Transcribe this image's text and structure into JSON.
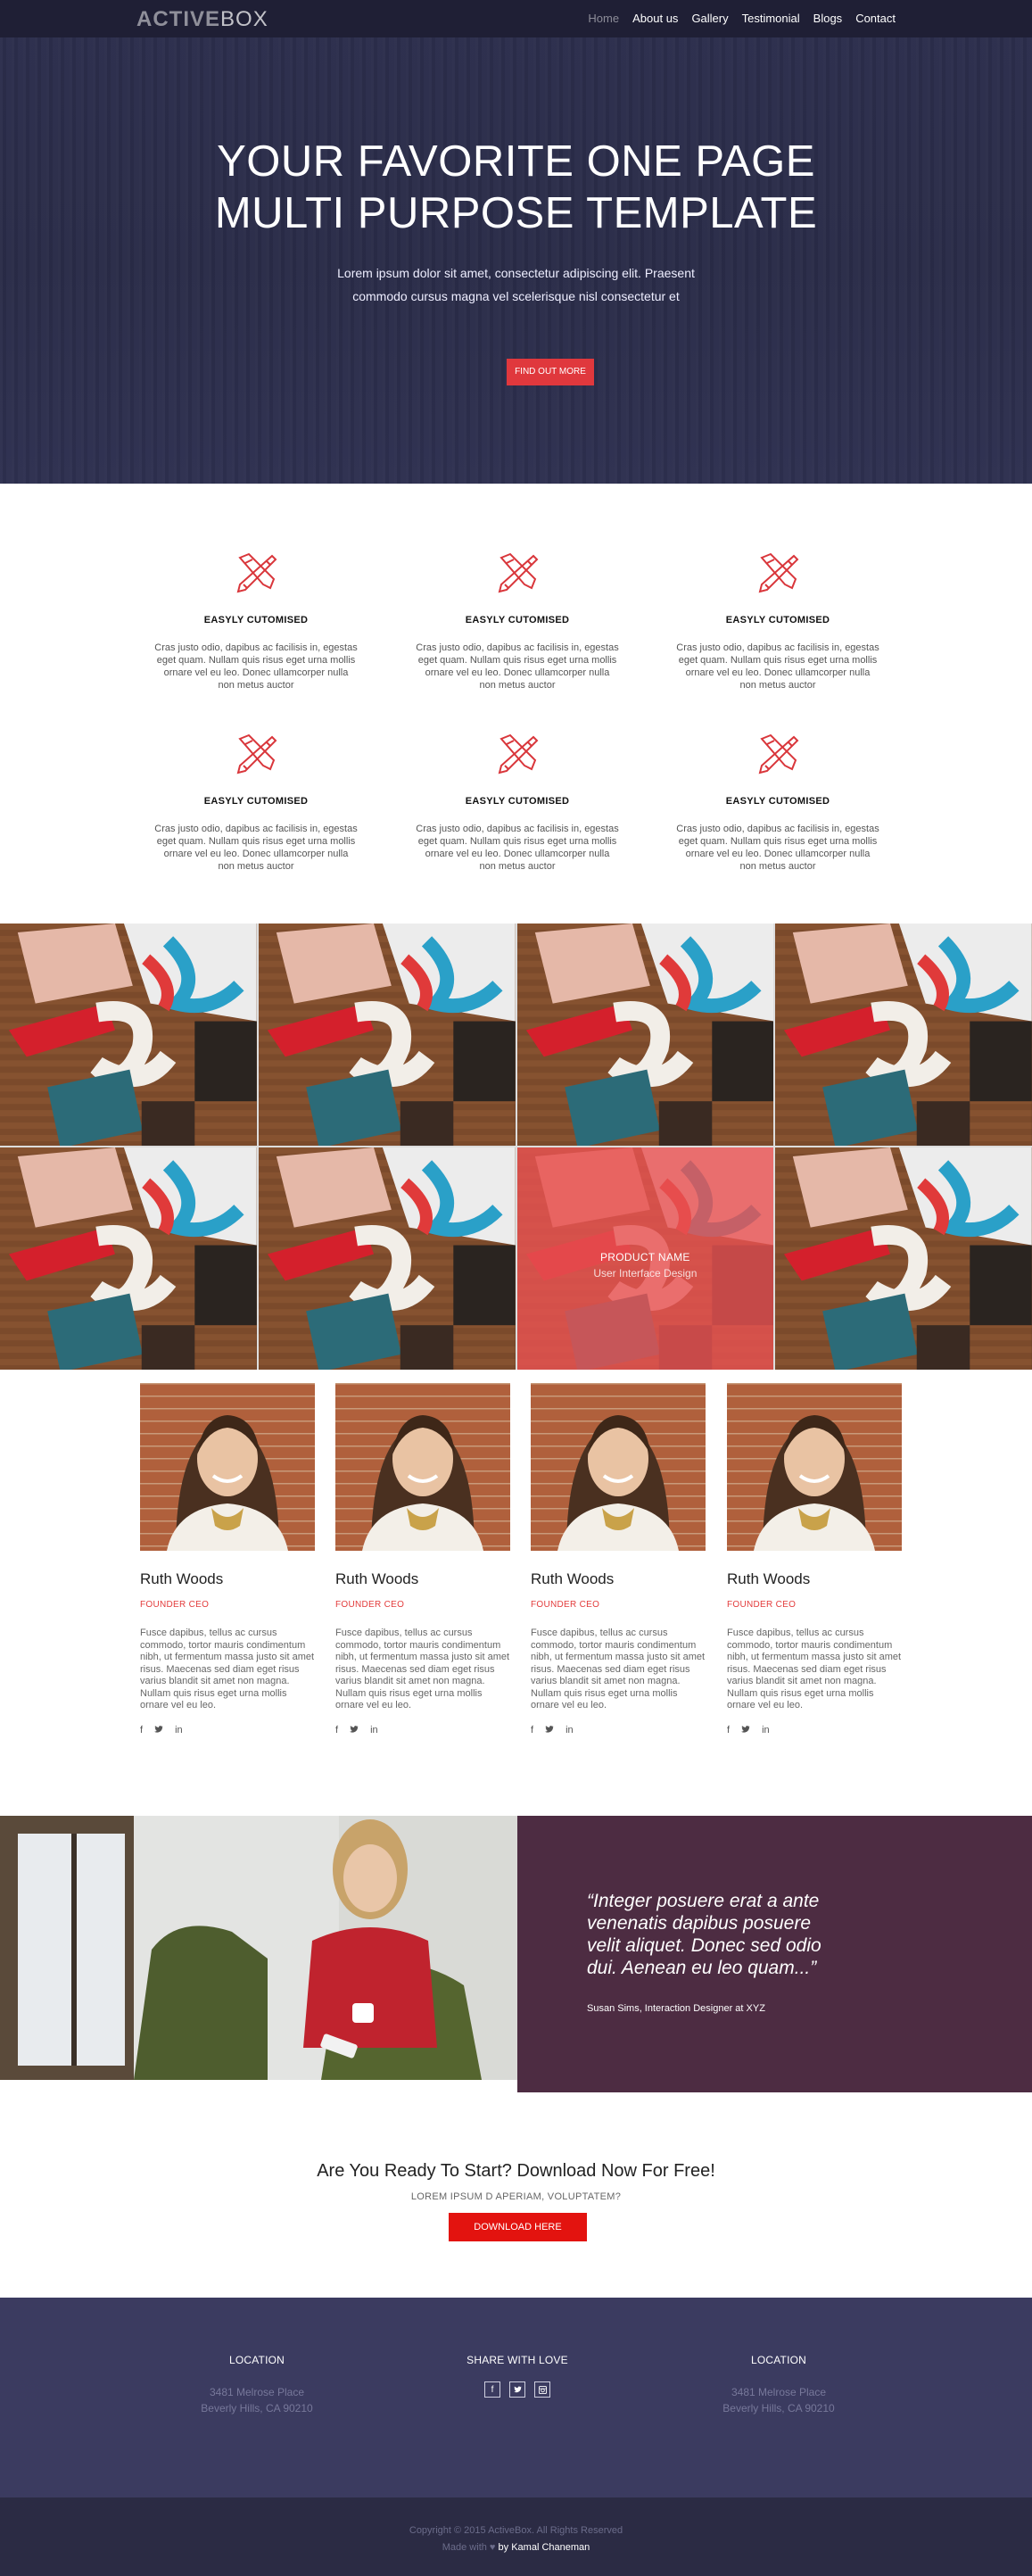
{
  "brand": {
    "logo_bold": "ACTIVE",
    "logo_light": "BOX"
  },
  "nav": {
    "items": [
      {
        "label": "Home",
        "active": true
      },
      {
        "label": "About us"
      },
      {
        "label": "Gallery"
      },
      {
        "label": "Testimonial"
      },
      {
        "label": "Blogs"
      },
      {
        "label": "Contact"
      }
    ]
  },
  "hero": {
    "title_line1": "YOUR FAVORITE ONE PAGE",
    "title_line2": "MULTI PURPOSE TEMPLATE",
    "text": "Lorem ipsum dolor sit amet, consectetur adipiscing elit. Praesent commodo cursus magna vel scelerisque nisl consectetur et",
    "button": "FIND OUT MORE"
  },
  "features": [
    {
      "icon": "pencil-ruler-icon",
      "title": "EASYLY CUTOMISED",
      "text": "Cras justo odio, dapibus ac facilisis in, egestas eget quam. Nullam quis risus eget urna mollis ornare vel eu leo. Donec ullamcorper nulla non metus auctor"
    },
    {
      "icon": "pencil-ruler-icon",
      "title": "EASYLY CUTOMISED",
      "text": "Cras justo odio, dapibus ac facilisis in, egestas eget quam. Nullam quis risus eget urna mollis ornare vel eu leo. Donec ullamcorper nulla non metus auctor"
    },
    {
      "icon": "pencil-ruler-icon",
      "title": "EASYLY CUTOMISED",
      "text": "Cras justo odio, dapibus ac facilisis in, egestas eget quam. Nullam quis risus eget urna mollis ornare vel eu leo. Donec ullamcorper nulla non metus auctor"
    },
    {
      "icon": "pencil-ruler-icon",
      "title": "EASYLY CUTOMISED",
      "text": "Cras justo odio, dapibus ac facilisis in, egestas eget quam. Nullam quis risus eget urna mollis ornare vel eu leo. Donec ullamcorper nulla non metus auctor"
    },
    {
      "icon": "pencil-ruler-icon",
      "title": "EASYLY CUTOMISED",
      "text": "Cras justo odio, dapibus ac facilisis in, egestas eget quam. Nullam quis risus eget urna mollis ornare vel eu leo. Donec ullamcorper nulla non metus auctor"
    },
    {
      "icon": "pencil-ruler-icon",
      "title": "EASYLY CUTOMISED",
      "text": "Cras justo odio, dapibus ac facilisis in, egestas eget quam. Nullam quis risus eget urna mollis ornare vel eu leo. Donec ullamcorper nulla non metus auctor"
    }
  ],
  "gallery": {
    "overlay": {
      "name": "PRODUCT NAME",
      "desc": "User Interface Design"
    }
  },
  "team": [
    {
      "name": "Ruth Woods",
      "role": "FOUNDER CEO",
      "bio": "Fusce dapibus, tellus ac cursus commodo, tortor mauris condimentum nibh, ut fermentum massa justo sit amet risus. Maecenas sed diam eget risus varius blandit sit amet non magna. Nullam quis risus eget urna mollis ornare vel eu leo."
    },
    {
      "name": "Ruth Woods",
      "role": "FOUNDER CEO",
      "bio": "Fusce dapibus, tellus ac cursus commodo, tortor mauris condimentum nibh, ut fermentum massa justo sit amet risus. Maecenas sed diam eget risus varius blandit sit amet non magna. Nullam quis risus eget urna mollis ornare vel eu leo."
    },
    {
      "name": "Ruth Woods",
      "role": "FOUNDER CEO",
      "bio": "Fusce dapibus, tellus ac cursus commodo, tortor mauris condimentum nibh, ut fermentum massa justo sit amet risus. Maecenas sed diam eget risus varius blandit sit amet non magna. Nullam quis risus eget urna mollis ornare vel eu leo."
    },
    {
      "name": "Ruth Woods",
      "role": "FOUNDER CEO",
      "bio": "Fusce dapibus, tellus ac cursus commodo, tortor mauris condimentum nibh, ut fermentum massa justo sit amet risus. Maecenas sed diam eget risus varius blandit sit amet non magna. Nullam quis risus eget urna mollis ornare vel eu leo."
    }
  ],
  "social_icons": {
    "facebook": "f",
    "twitter": "🐦",
    "linkedin": "in"
  },
  "testimonial": {
    "quote": "“Integer posuere erat a ante venenatis dapibus posuere velit aliquet. Donec sed odio dui. Aenean eu leo quam...”",
    "author": "Susan Sims, Interaction Designer at XYZ"
  },
  "cta": {
    "title": "Are You Ready To Start? Download Now For Free!",
    "subtitle": "LOREM IPSUM D APERIAM, VOLUPTATEM?",
    "button": "DOWNLOAD HERE"
  },
  "footer": {
    "col1": {
      "title": "LOCATION",
      "line1": "3481 Melrose Place",
      "line2": "Beverly Hills, CA 90210"
    },
    "col2": {
      "title": "SHARE WITH LOVE",
      "icons": [
        "facebook-icon",
        "twitter-icon",
        "instagram-icon"
      ]
    },
    "col3": {
      "title": "LOCATION",
      "line1": "3481 Melrose Place",
      "line2": "Beverly Hills, CA 90210"
    },
    "copyright": "Copyright © 2015 ActiveBox. All Rights Reserved",
    "made_with": "Made with ♥",
    "made_by": "by Kamal Chaneman"
  },
  "colors": {
    "accent": "#e0383d",
    "nav_bg": "#1f1f35",
    "hero_bg": "#2c2e4d",
    "quote_bg": "#4d2c42",
    "footer_bg": "#3b3b60",
    "footer_bottom": "#2b2b44"
  }
}
